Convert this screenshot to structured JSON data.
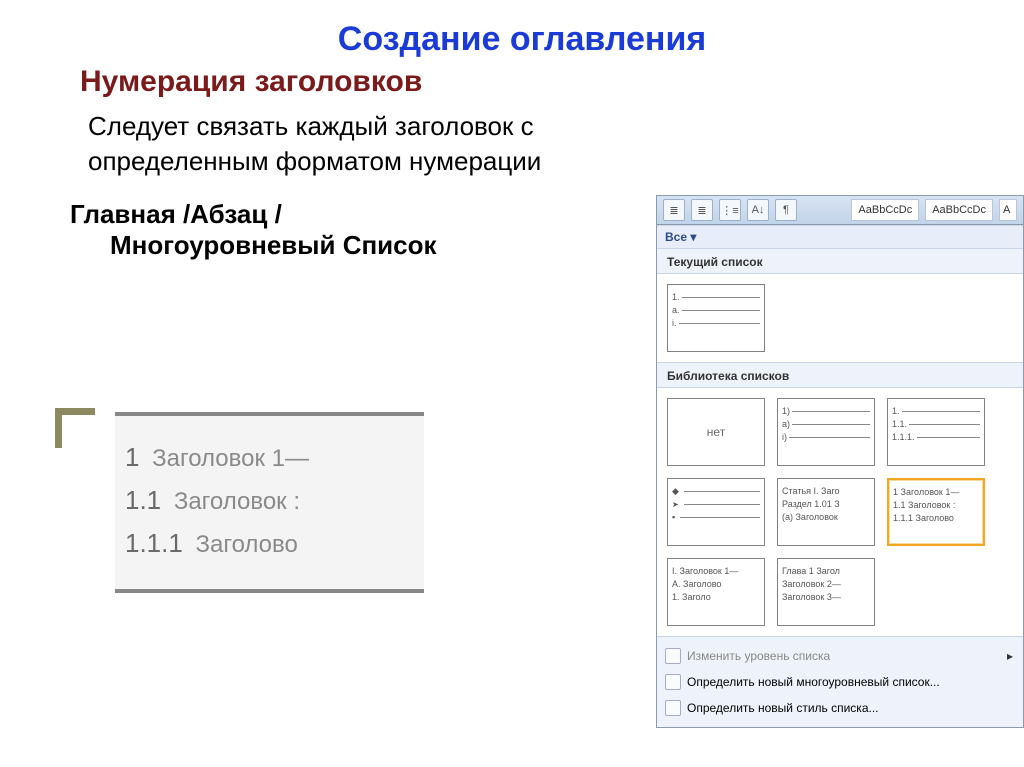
{
  "title": "Создание оглавления",
  "subtitle": "Нумерация заголовков",
  "body": "Следует связать каждый заголовок с определенным форматом нумерации",
  "path_line1": "Главная /Абзац /",
  "path_line2": "Многоуровневый Список",
  "example": {
    "r1_num": "1",
    "r1_txt": "Заголовок 1—",
    "r2_num": "1.1",
    "r2_txt": "Заголовок :",
    "r3_num": "1.1.1",
    "r3_txt": "Заголово"
  },
  "panel": {
    "style1": "AaBbCcDc",
    "style2": "AaBbCcDc",
    "styleA": "A",
    "all": "Все ▾",
    "sec_current": "Текущий список",
    "sec_library": "Библиотека списков",
    "thumb_current": {
      "l1": "1.",
      "l2": "a.",
      "l3": "i."
    },
    "thumb_none": "нет",
    "lib": {
      "r1c2": {
        "l1": "1)",
        "l2": "a)",
        "l3": "i)"
      },
      "r1c3": {
        "l1": "1.",
        "l2": "1.1.",
        "l3": "1.1.1."
      },
      "r2c2": {
        "l1": "Статья I. Заго",
        "l2": "Раздел 1.01 З",
        "l3": "(a) Заголовок"
      },
      "r2c3": {
        "l1": "1 Заголовок 1—",
        "l2": "1.1 Заголовок :",
        "l3": "1.1.1 Заголово"
      },
      "r3c1": {
        "l1": "I. Заголовок 1—",
        "l2": "A. Заголово",
        "l3": "1. Заголо"
      },
      "r3c2": {
        "l1": "Глава 1 Загол",
        "l2": "Заголовок 2—",
        "l3": "Заголовок 3—"
      }
    },
    "menu": {
      "change": "Изменить уровень списка",
      "define_ml": "Определить новый многоуровневый список...",
      "define_style": "Определить новый стиль списка..."
    }
  }
}
